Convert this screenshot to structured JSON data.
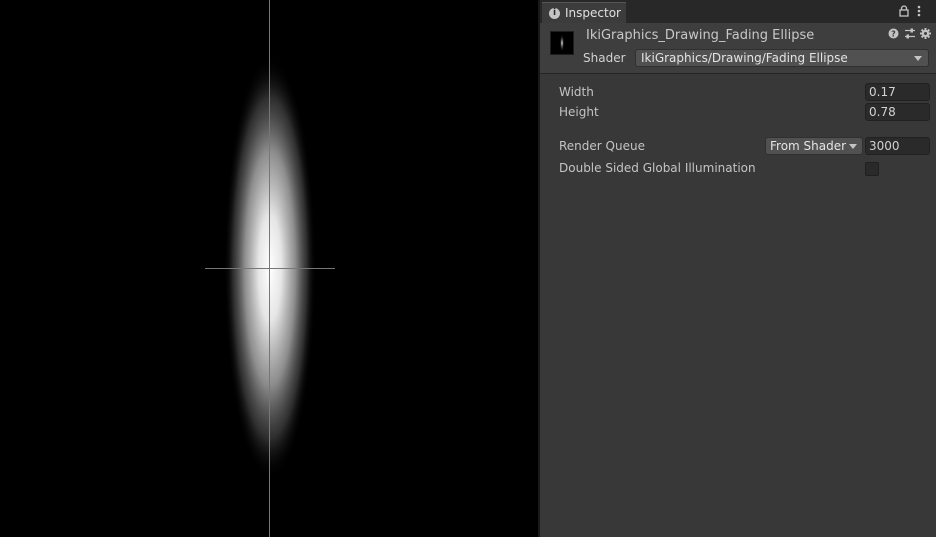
{
  "preview": {
    "background_color": "#000000",
    "crosshair_color": "#777777"
  },
  "inspector": {
    "tab": {
      "icon": "info-icon",
      "icon_glyph": "i",
      "label": "Inspector"
    },
    "tab_icons": [
      "lock-icon",
      "menu-dots-icon"
    ],
    "material": {
      "name": "IkiGraphics_Drawing_Fading Ellipse",
      "header_icons": [
        "help-icon",
        "preset-icon",
        "gear-icon"
      ],
      "shader_label": "Shader",
      "shader_value": "IkiGraphics/Drawing/Fading Ellipse"
    },
    "properties": {
      "width": {
        "label": "Width",
        "value": "0.17"
      },
      "height": {
        "label": "Height",
        "value": "0.78"
      },
      "render_queue": {
        "label": "Render Queue",
        "mode": "From Shader",
        "value": "3000"
      },
      "double_sided_gi": {
        "label": "Double Sided Global Illumination",
        "checked": false
      }
    }
  },
  "colors": {
    "panel_bg": "#383838",
    "tabbar_bg": "#282828",
    "field_bg": "#2a2a2a",
    "dropdown_bg": "#515151"
  }
}
